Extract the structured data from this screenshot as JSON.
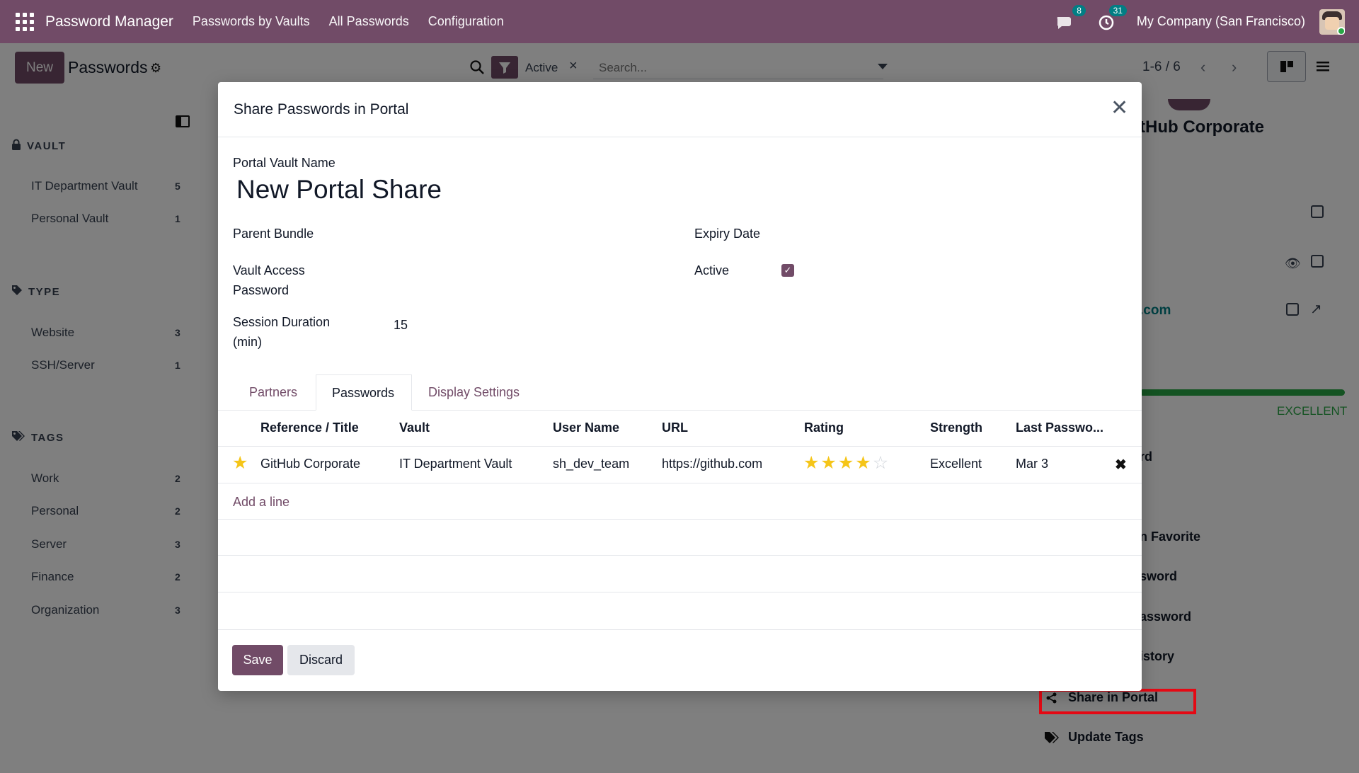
{
  "navbar": {
    "app_name": "Password Manager",
    "menu": [
      "Passwords by Vaults",
      "All Passwords",
      "Configuration"
    ],
    "messages_count": "8",
    "activities_count": "31",
    "company": "My Company (San Francisco)"
  },
  "control_panel": {
    "new_label": "New",
    "title": "Passwords",
    "facet": "Active",
    "search_placeholder": "Search...",
    "pager": "1-6 / 6"
  },
  "sidebar": {
    "vault": {
      "title": "VAULT",
      "items": [
        {
          "label": "IT Department Vault",
          "count": "5"
        },
        {
          "label": "Personal Vault",
          "count": "1"
        }
      ]
    },
    "type": {
      "title": "TYPE",
      "items": [
        {
          "label": "Website",
          "count": "3"
        },
        {
          "label": "SSH/Server",
          "count": "1"
        }
      ]
    },
    "tags": {
      "title": "TAGS",
      "items": [
        {
          "label": "Work",
          "count": "2"
        },
        {
          "label": "Personal",
          "count": "2"
        },
        {
          "label": "Server",
          "count": "3"
        },
        {
          "label": "Finance",
          "count": "2"
        },
        {
          "label": "Organization",
          "count": "3"
        }
      ]
    }
  },
  "background_panel": {
    "title_fragment": "tHub Corporate",
    "url_fragment": ".com",
    "strength": "EXCELLENT",
    "actions": [
      "rd",
      "n Favorite",
      "sword",
      "assword",
      "istory",
      "Share in Portal",
      "Update Tags"
    ]
  },
  "modal": {
    "title": "Share Passwords in Portal",
    "portal_vault_name_label": "Portal Vault Name",
    "portal_vault_name": "New Portal Share",
    "parent_bundle_label": "Parent Bundle",
    "vault_access_password_label_1": "Vault Access",
    "vault_access_password_label_2": "Password",
    "session_duration_label_1": "Session Duration",
    "session_duration_label_2": "(min)",
    "session_duration": "15",
    "expiry_date_label": "Expiry Date",
    "active_label": "Active",
    "tabs": [
      "Partners",
      "Passwords",
      "Display Settings"
    ],
    "table": {
      "headers": [
        "Reference / Title",
        "Vault",
        "User Name",
        "URL",
        "Rating",
        "Strength",
        "Last Passwo..."
      ],
      "rows": [
        {
          "title": "GitHub Corporate",
          "vault": "IT Department Vault",
          "user": "sh_dev_team",
          "url": "https://github.com",
          "rating": 4,
          "rating_max": 5,
          "strength": "Excellent",
          "last": "Mar 3"
        }
      ]
    },
    "add_line": "Add a line",
    "save_label": "Save",
    "discard_label": "Discard"
  },
  "colors": {
    "brand": "#714b67",
    "success": "#28a745",
    "highlight": "#e50914"
  }
}
